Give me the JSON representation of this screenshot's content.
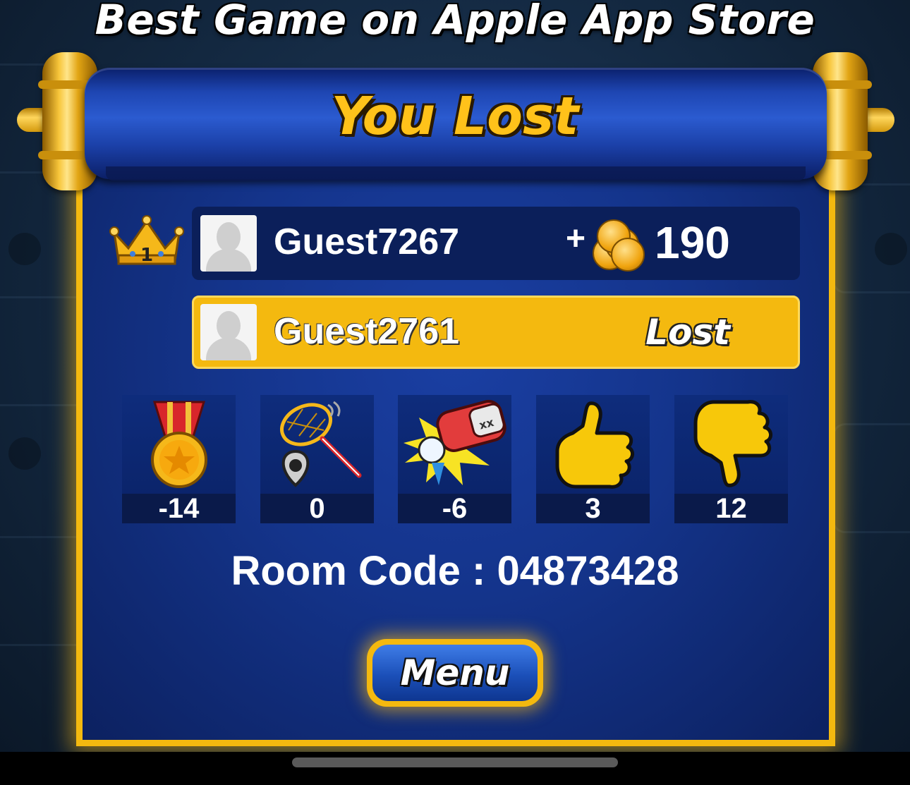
{
  "header": {
    "headline": "Best Game on Apple App Store"
  },
  "result": {
    "title": "You Lost"
  },
  "players": [
    {
      "name": "Guest7267",
      "rank": "1",
      "reward_prefix": "+",
      "reward": "190",
      "icon": "coins-icon"
    },
    {
      "name": "Guest2761",
      "status": "Lost"
    }
  ],
  "stats": [
    {
      "icon": "medal-icon",
      "value": "-14"
    },
    {
      "icon": "net-capture-icon",
      "value": "0"
    },
    {
      "icon": "knockout-glove-icon",
      "value": "-6"
    },
    {
      "icon": "thumbs-up-icon",
      "value": "3"
    },
    {
      "icon": "thumbs-down-icon",
      "value": "12"
    }
  ],
  "room": {
    "code_text": "Room Code : 04873428"
  },
  "actions": {
    "menu_label": "Menu"
  },
  "colors": {
    "gold": "#f4b90f",
    "panel_blue": "#14348b",
    "title_gold": "#ffc21a"
  }
}
